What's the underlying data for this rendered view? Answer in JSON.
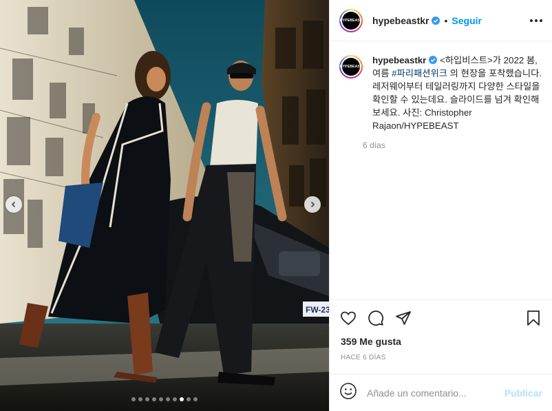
{
  "post": {
    "author": "hypebeastkr",
    "avatar_text": "HYPEBEAST",
    "follow_label": "Seguir",
    "caption_author": "hypebeastkr",
    "caption_part1": " <하입비스트>가 2022 봄, 여름 ",
    "caption_hashtag": "#파리패션위크",
    "caption_part2": " 의 현장을 포착했습니다. 레저웨어부터 테일러링까지 다양한 스타일을 확인할 수 있는데요. 슬라이드를 넘겨 확인해 보세요. 사진: Christopher Rajaon/HYPEBEAST",
    "caption_time": "6 días",
    "likes": "359 Me gusta",
    "ago": "HACE 6 DÍAS",
    "comment_placeholder": "Añade un comentario...",
    "publish_label": "Publicar"
  },
  "carousel": {
    "total_slides": 10,
    "active_slide": 8,
    "car_plate": "FW-23"
  },
  "colors": {
    "accent_blue": "#0095f6",
    "verified_blue": "#3897f0",
    "hashtag": "#00376b",
    "muted": "#8e8e8e",
    "publish_disabled": "#b2dffc"
  },
  "icons": {
    "like": "heart-icon",
    "comment": "comment-icon",
    "share": "paper-plane-icon",
    "save": "bookmark-icon",
    "emoji": "smiley-icon",
    "verified": "verified-badge-icon",
    "more": "more-options-icon"
  }
}
